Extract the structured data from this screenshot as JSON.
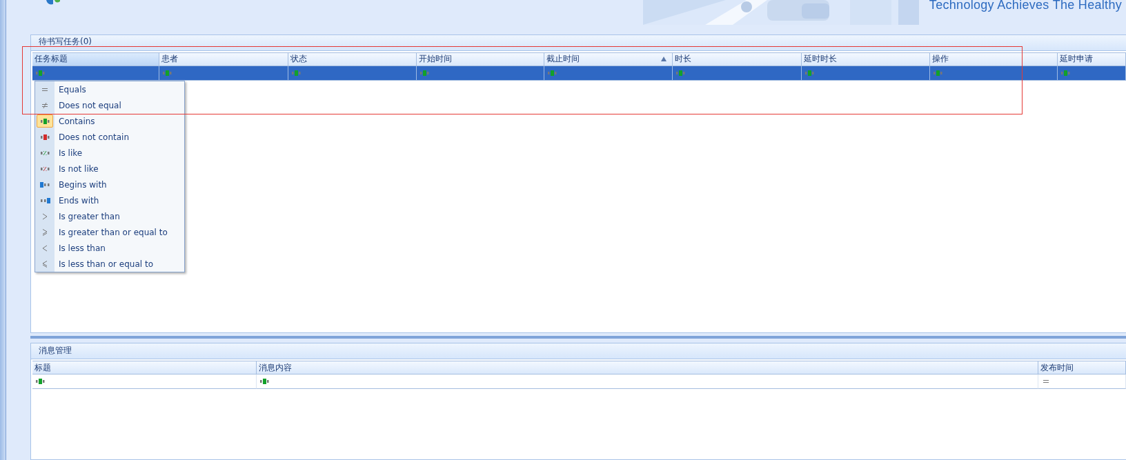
{
  "header": {
    "slogan": "Technology Achieves The Healthy"
  },
  "task_panel": {
    "title": "待书写任务(0)",
    "columns": [
      {
        "label": "任务标题",
        "sorted": false,
        "active": true
      },
      {
        "label": "患者",
        "sorted": false,
        "active": false
      },
      {
        "label": "状态",
        "sorted": false,
        "active": false
      },
      {
        "label": "开始时间",
        "sorted": false,
        "active": false
      },
      {
        "label": "截止时间",
        "sorted": true,
        "active": false
      },
      {
        "label": "时长",
        "sorted": false,
        "active": false
      },
      {
        "label": "延时时长",
        "sorted": false,
        "active": false
      },
      {
        "label": "操作",
        "sorted": false,
        "active": false
      },
      {
        "label": "延时申请",
        "sorted": false,
        "active": false
      }
    ],
    "filter_row": {
      "selected": true,
      "cells": [
        {
          "kind": "contains"
        },
        {
          "kind": "contains"
        },
        {
          "kind": "contains"
        },
        {
          "kind": "contains"
        },
        {
          "kind": "contains"
        },
        {
          "kind": "contains"
        },
        {
          "kind": "contains"
        },
        {
          "kind": "contains"
        },
        {
          "kind": "contains"
        }
      ]
    }
  },
  "filter_menu": [
    {
      "label": "Equals",
      "kind": "equals",
      "selected": false
    },
    {
      "label": "Does not equal",
      "kind": "not_equal",
      "selected": false
    },
    {
      "label": "Contains",
      "kind": "contains",
      "selected": true
    },
    {
      "label": "Does not contain",
      "kind": "not_contains",
      "selected": false
    },
    {
      "label": "Is like",
      "kind": "like",
      "selected": false
    },
    {
      "label": "Is not like",
      "kind": "not_like",
      "selected": false
    },
    {
      "label": "Begins with",
      "kind": "begins",
      "selected": false
    },
    {
      "label": "Ends with",
      "kind": "ends",
      "selected": false
    },
    {
      "label": "Is greater than",
      "kind": "gt",
      "selected": false
    },
    {
      "label": "Is greater than or equal to",
      "kind": "gte",
      "selected": false
    },
    {
      "label": "Is less than",
      "kind": "lt",
      "selected": false
    },
    {
      "label": "Is less than or equal to",
      "kind": "lte",
      "selected": false
    }
  ],
  "message_panel": {
    "title": "消息管理",
    "columns": [
      {
        "label": "标题",
        "sorted": false,
        "active": false
      },
      {
        "label": "消息内容",
        "sorted": false,
        "active": false
      },
      {
        "label": "发布时间",
        "sorted": false,
        "active": false
      }
    ],
    "filter_row": {
      "selected": false,
      "cells": [
        {
          "kind": "contains"
        },
        {
          "kind": "contains"
        },
        {
          "kind": "equals"
        }
      ]
    }
  }
}
